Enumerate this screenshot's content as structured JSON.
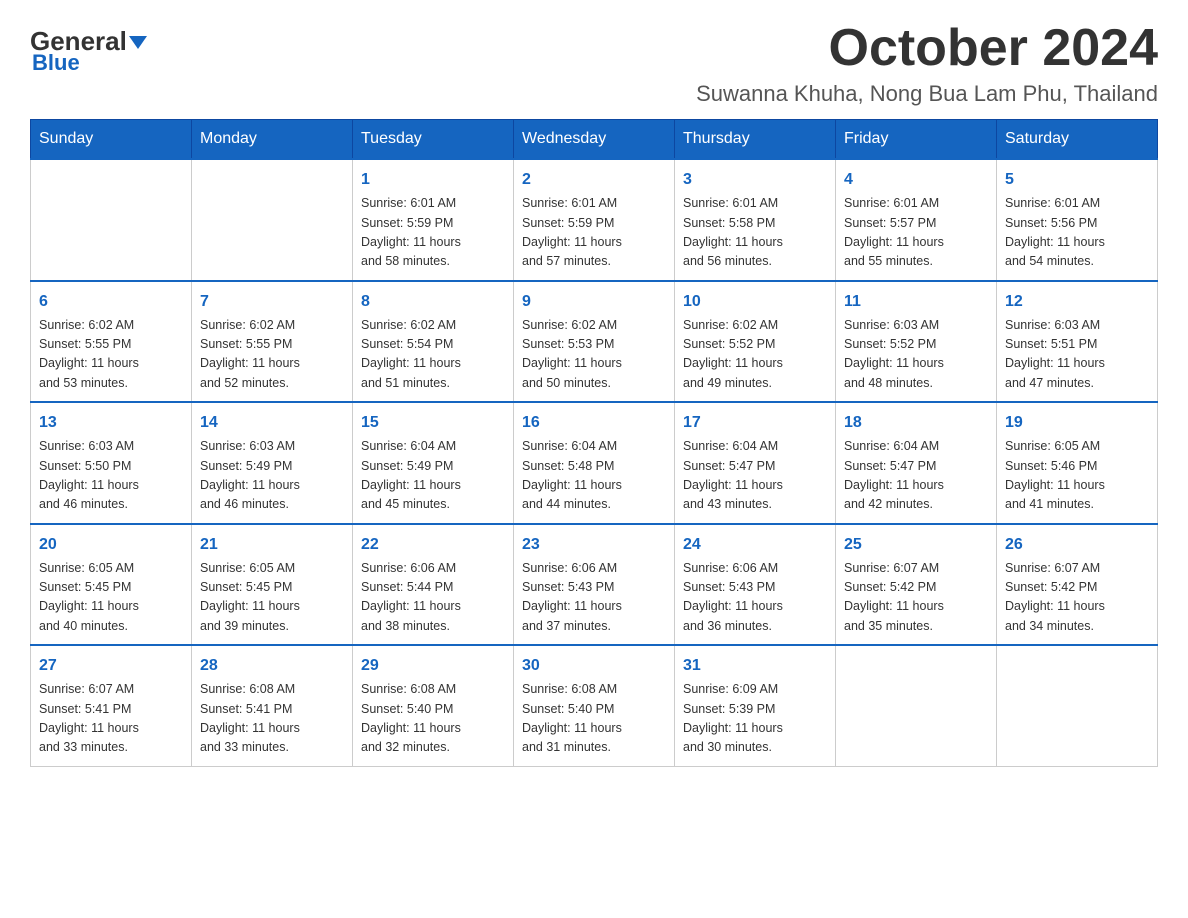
{
  "header": {
    "logo_general": "General",
    "logo_blue": "Blue",
    "month_title": "October 2024",
    "location": "Suwanna Khuha, Nong Bua Lam Phu, Thailand"
  },
  "weekdays": [
    "Sunday",
    "Monday",
    "Tuesday",
    "Wednesday",
    "Thursday",
    "Friday",
    "Saturday"
  ],
  "weeks": [
    [
      {
        "day": "",
        "info": ""
      },
      {
        "day": "",
        "info": ""
      },
      {
        "day": "1",
        "info": "Sunrise: 6:01 AM\nSunset: 5:59 PM\nDaylight: 11 hours\nand 58 minutes."
      },
      {
        "day": "2",
        "info": "Sunrise: 6:01 AM\nSunset: 5:59 PM\nDaylight: 11 hours\nand 57 minutes."
      },
      {
        "day": "3",
        "info": "Sunrise: 6:01 AM\nSunset: 5:58 PM\nDaylight: 11 hours\nand 56 minutes."
      },
      {
        "day": "4",
        "info": "Sunrise: 6:01 AM\nSunset: 5:57 PM\nDaylight: 11 hours\nand 55 minutes."
      },
      {
        "day": "5",
        "info": "Sunrise: 6:01 AM\nSunset: 5:56 PM\nDaylight: 11 hours\nand 54 minutes."
      }
    ],
    [
      {
        "day": "6",
        "info": "Sunrise: 6:02 AM\nSunset: 5:55 PM\nDaylight: 11 hours\nand 53 minutes."
      },
      {
        "day": "7",
        "info": "Sunrise: 6:02 AM\nSunset: 5:55 PM\nDaylight: 11 hours\nand 52 minutes."
      },
      {
        "day": "8",
        "info": "Sunrise: 6:02 AM\nSunset: 5:54 PM\nDaylight: 11 hours\nand 51 minutes."
      },
      {
        "day": "9",
        "info": "Sunrise: 6:02 AM\nSunset: 5:53 PM\nDaylight: 11 hours\nand 50 minutes."
      },
      {
        "day": "10",
        "info": "Sunrise: 6:02 AM\nSunset: 5:52 PM\nDaylight: 11 hours\nand 49 minutes."
      },
      {
        "day": "11",
        "info": "Sunrise: 6:03 AM\nSunset: 5:52 PM\nDaylight: 11 hours\nand 48 minutes."
      },
      {
        "day": "12",
        "info": "Sunrise: 6:03 AM\nSunset: 5:51 PM\nDaylight: 11 hours\nand 47 minutes."
      }
    ],
    [
      {
        "day": "13",
        "info": "Sunrise: 6:03 AM\nSunset: 5:50 PM\nDaylight: 11 hours\nand 46 minutes."
      },
      {
        "day": "14",
        "info": "Sunrise: 6:03 AM\nSunset: 5:49 PM\nDaylight: 11 hours\nand 46 minutes."
      },
      {
        "day": "15",
        "info": "Sunrise: 6:04 AM\nSunset: 5:49 PM\nDaylight: 11 hours\nand 45 minutes."
      },
      {
        "day": "16",
        "info": "Sunrise: 6:04 AM\nSunset: 5:48 PM\nDaylight: 11 hours\nand 44 minutes."
      },
      {
        "day": "17",
        "info": "Sunrise: 6:04 AM\nSunset: 5:47 PM\nDaylight: 11 hours\nand 43 minutes."
      },
      {
        "day": "18",
        "info": "Sunrise: 6:04 AM\nSunset: 5:47 PM\nDaylight: 11 hours\nand 42 minutes."
      },
      {
        "day": "19",
        "info": "Sunrise: 6:05 AM\nSunset: 5:46 PM\nDaylight: 11 hours\nand 41 minutes."
      }
    ],
    [
      {
        "day": "20",
        "info": "Sunrise: 6:05 AM\nSunset: 5:45 PM\nDaylight: 11 hours\nand 40 minutes."
      },
      {
        "day": "21",
        "info": "Sunrise: 6:05 AM\nSunset: 5:45 PM\nDaylight: 11 hours\nand 39 minutes."
      },
      {
        "day": "22",
        "info": "Sunrise: 6:06 AM\nSunset: 5:44 PM\nDaylight: 11 hours\nand 38 minutes."
      },
      {
        "day": "23",
        "info": "Sunrise: 6:06 AM\nSunset: 5:43 PM\nDaylight: 11 hours\nand 37 minutes."
      },
      {
        "day": "24",
        "info": "Sunrise: 6:06 AM\nSunset: 5:43 PM\nDaylight: 11 hours\nand 36 minutes."
      },
      {
        "day": "25",
        "info": "Sunrise: 6:07 AM\nSunset: 5:42 PM\nDaylight: 11 hours\nand 35 minutes."
      },
      {
        "day": "26",
        "info": "Sunrise: 6:07 AM\nSunset: 5:42 PM\nDaylight: 11 hours\nand 34 minutes."
      }
    ],
    [
      {
        "day": "27",
        "info": "Sunrise: 6:07 AM\nSunset: 5:41 PM\nDaylight: 11 hours\nand 33 minutes."
      },
      {
        "day": "28",
        "info": "Sunrise: 6:08 AM\nSunset: 5:41 PM\nDaylight: 11 hours\nand 33 minutes."
      },
      {
        "day": "29",
        "info": "Sunrise: 6:08 AM\nSunset: 5:40 PM\nDaylight: 11 hours\nand 32 minutes."
      },
      {
        "day": "30",
        "info": "Sunrise: 6:08 AM\nSunset: 5:40 PM\nDaylight: 11 hours\nand 31 minutes."
      },
      {
        "day": "31",
        "info": "Sunrise: 6:09 AM\nSunset: 5:39 PM\nDaylight: 11 hours\nand 30 minutes."
      },
      {
        "day": "",
        "info": ""
      },
      {
        "day": "",
        "info": ""
      }
    ]
  ]
}
